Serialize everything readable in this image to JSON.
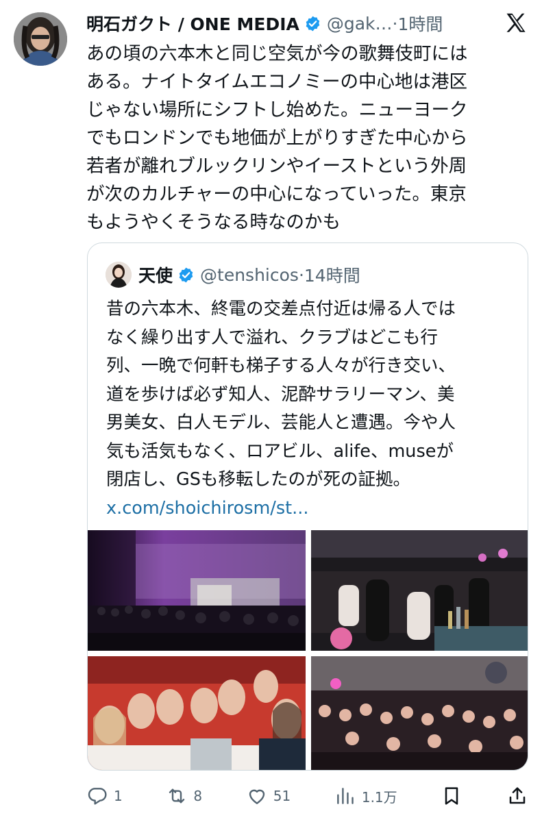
{
  "tweet": {
    "author_name": "明石ガクト / ONE MEDIA",
    "handle": "@gak…",
    "separator": "·",
    "time": "1時間",
    "text_lines": [
      "あの頃の六本木と同じ空気が今の歌舞伎町には",
      "ある。ナイトタイムエコノミーの中心地は港区",
      "じゃない場所にシフトし始めた。ニューヨーク",
      "でもロンドンでも地価が上がりすぎた中心から",
      "若者が離れブルックリンやイーストという外周",
      "が次のカルチャーの中心になっていった。東京",
      "もようやくそうなる時なのかも"
    ]
  },
  "quote": {
    "author_name": "天使",
    "handle": "@tenshicos",
    "separator": "·",
    "time": "14時間",
    "text_lines": [
      "昔の六本木、終電の交差点付近は帰る人では",
      "なく繰り出す人で溢れ、クラブはどこも行",
      "列、一晩で何軒も梯子する人々が行き交い、",
      "道を歩けば必ず知人、泥酔サラリーマン、美",
      "男美女、白人モデル、芸能人と遭遇。今や人",
      "気も活気もなく、ロアビル、alife、museが",
      "閉店し、GSも移転したのが死の証拠。"
    ],
    "link": "x.com/shoichirosm/st..."
  },
  "actions": {
    "replies": "1",
    "reposts": "8",
    "likes": "51",
    "views": "1.1万"
  },
  "colors": {
    "verified": "#1d9bf0",
    "secondary_text": "#536471",
    "link": "#1d6fa5",
    "border": "#cfd9de"
  }
}
